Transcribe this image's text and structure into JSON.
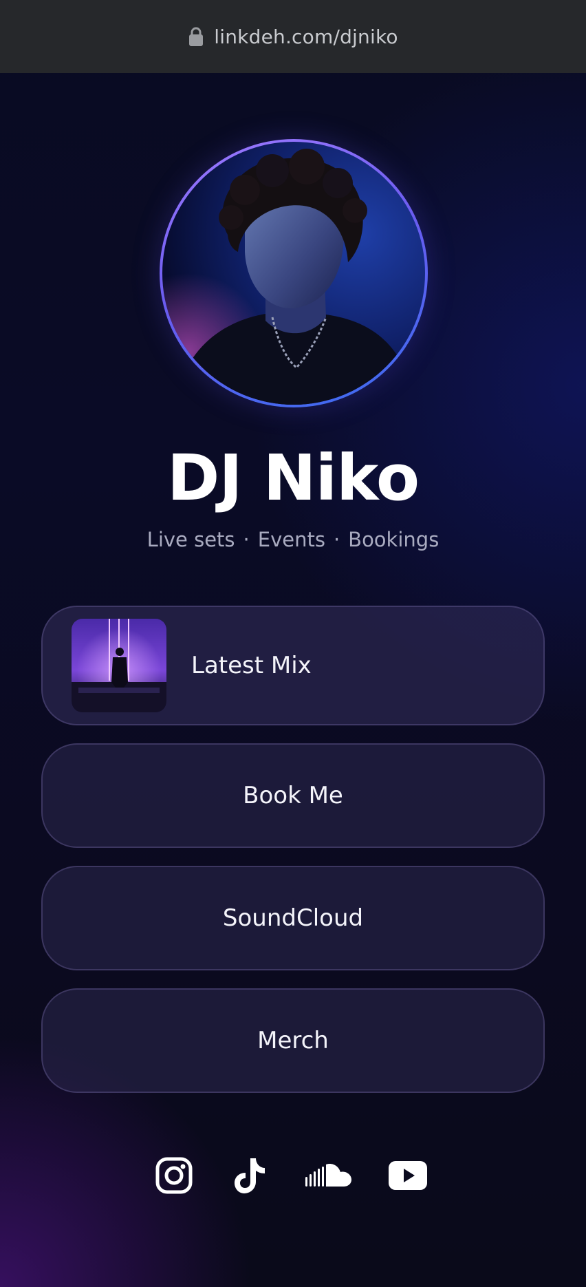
{
  "browser": {
    "url": "linkdeh.com/djniko",
    "lock_icon": "lock-icon"
  },
  "profile": {
    "name": "DJ Niko",
    "tagline": [
      "Live sets",
      "Events",
      "Bookings"
    ],
    "separator": "·"
  },
  "links": [
    {
      "label": "Latest Mix",
      "thumbnail": "dj-silhouette-neon-stage"
    },
    {
      "label": "Book Me"
    },
    {
      "label": "SoundCloud"
    },
    {
      "label": "Merch"
    }
  ],
  "socials": [
    {
      "name": "instagram-icon"
    },
    {
      "name": "tiktok-icon"
    },
    {
      "name": "soundcloud-icon"
    },
    {
      "name": "youtube-icon"
    }
  ],
  "colors": {
    "ring_start": "#a07bff",
    "ring_end": "#3a6df0",
    "background": "#0a0b26",
    "button_bg": "#2c284e"
  }
}
